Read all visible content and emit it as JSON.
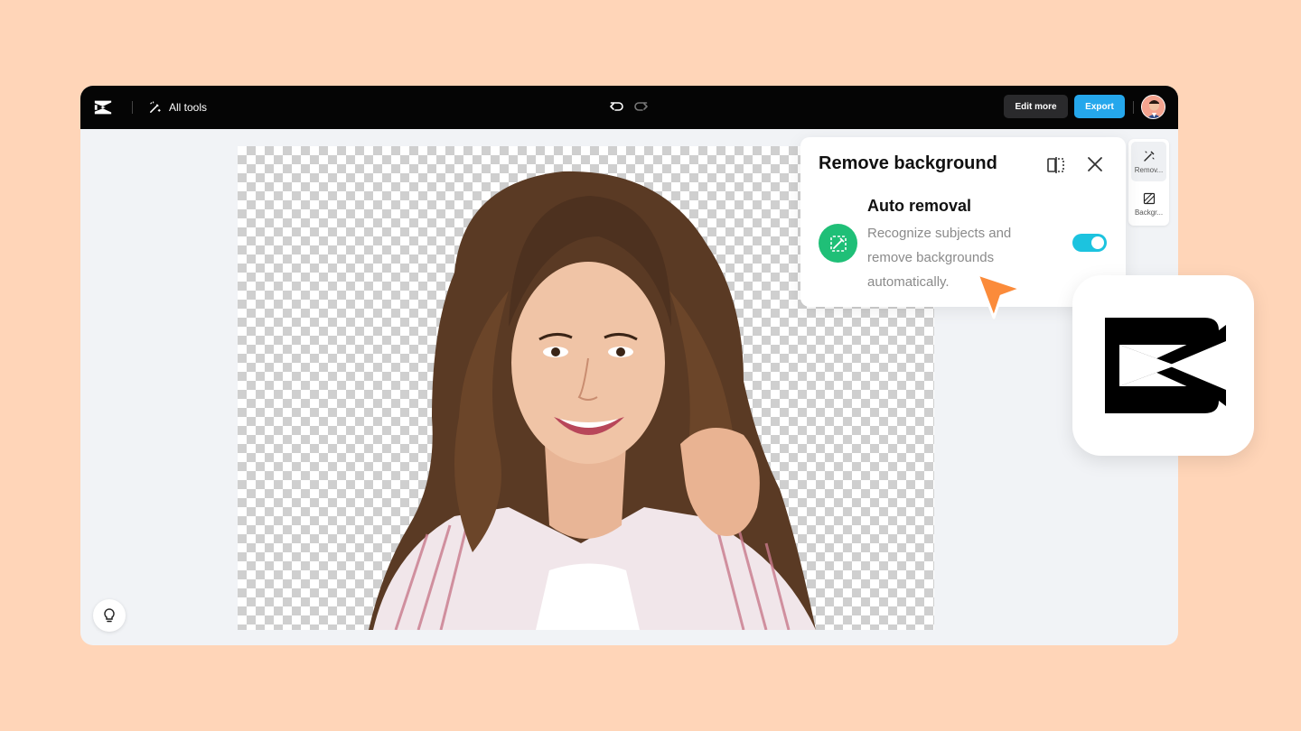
{
  "toolbar": {
    "all_tools_label": "All tools",
    "edit_more_label": "Edit more",
    "export_label": "Export"
  },
  "panel": {
    "title": "Remove background",
    "auto_title": "Auto removal",
    "auto_desc_line1": "Recognize subjects and",
    "auto_desc_line2": "remove backgrounds",
    "auto_desc_line3": "automatically.",
    "toggle_on": true
  },
  "rail": {
    "items": [
      {
        "label": "Remov...",
        "icon": "magic-wand-icon"
      },
      {
        "label": "Backgr...",
        "icon": "background-icon"
      }
    ]
  },
  "colors": {
    "page_bg": "#ffd5b8",
    "topbar_bg": "#050505",
    "export_blue": "#25a7ec",
    "toggle_cyan": "#1cc3df",
    "auto_green": "#1fbf77",
    "cursor_orange": "#fb8b3a"
  }
}
